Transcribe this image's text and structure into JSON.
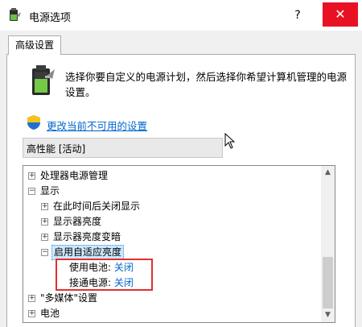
{
  "window": {
    "title": "电源选项",
    "help_label": "?",
    "close_label": "✕",
    "app_icon": "battery-app-icon"
  },
  "tabs": [
    {
      "label": "高级设置",
      "active": true
    }
  ],
  "intro": {
    "icon": "battery-icon",
    "text": "选择你要自定义的电源计划，然后选择你希望计算机管理的电源设置。"
  },
  "change_link": {
    "icon": "uac-shield-icon",
    "label": "更改当前不可用的设置"
  },
  "plan_select": {
    "value": "高性能 [活动]"
  },
  "tree": {
    "items": [
      {
        "label": "处理器电源管理",
        "expander": "+"
      },
      {
        "label": "显示",
        "expander": "−"
      },
      {
        "label": "在此时间后关闭显示",
        "expander": "+"
      },
      {
        "label": "显示器亮度",
        "expander": "+"
      },
      {
        "label": "显示器亮度变暗",
        "expander": "+"
      },
      {
        "label": "启用自适应亮度",
        "expander": "−",
        "selected": true
      },
      {
        "label": "使用电池:",
        "value": "关闭"
      },
      {
        "label": "接通电源:",
        "value": "关闭"
      },
      {
        "label": "\"多媒体\"设置",
        "expander": "+"
      },
      {
        "label": "电池",
        "expander": "+"
      }
    ]
  },
  "scrollbar": {
    "up_icon": "▲",
    "down_icon": "▼"
  },
  "colors": {
    "accent": "#0066cc",
    "close_button": "#e81123",
    "selection": "#cce8ff",
    "highlight_box": "#e03030"
  }
}
